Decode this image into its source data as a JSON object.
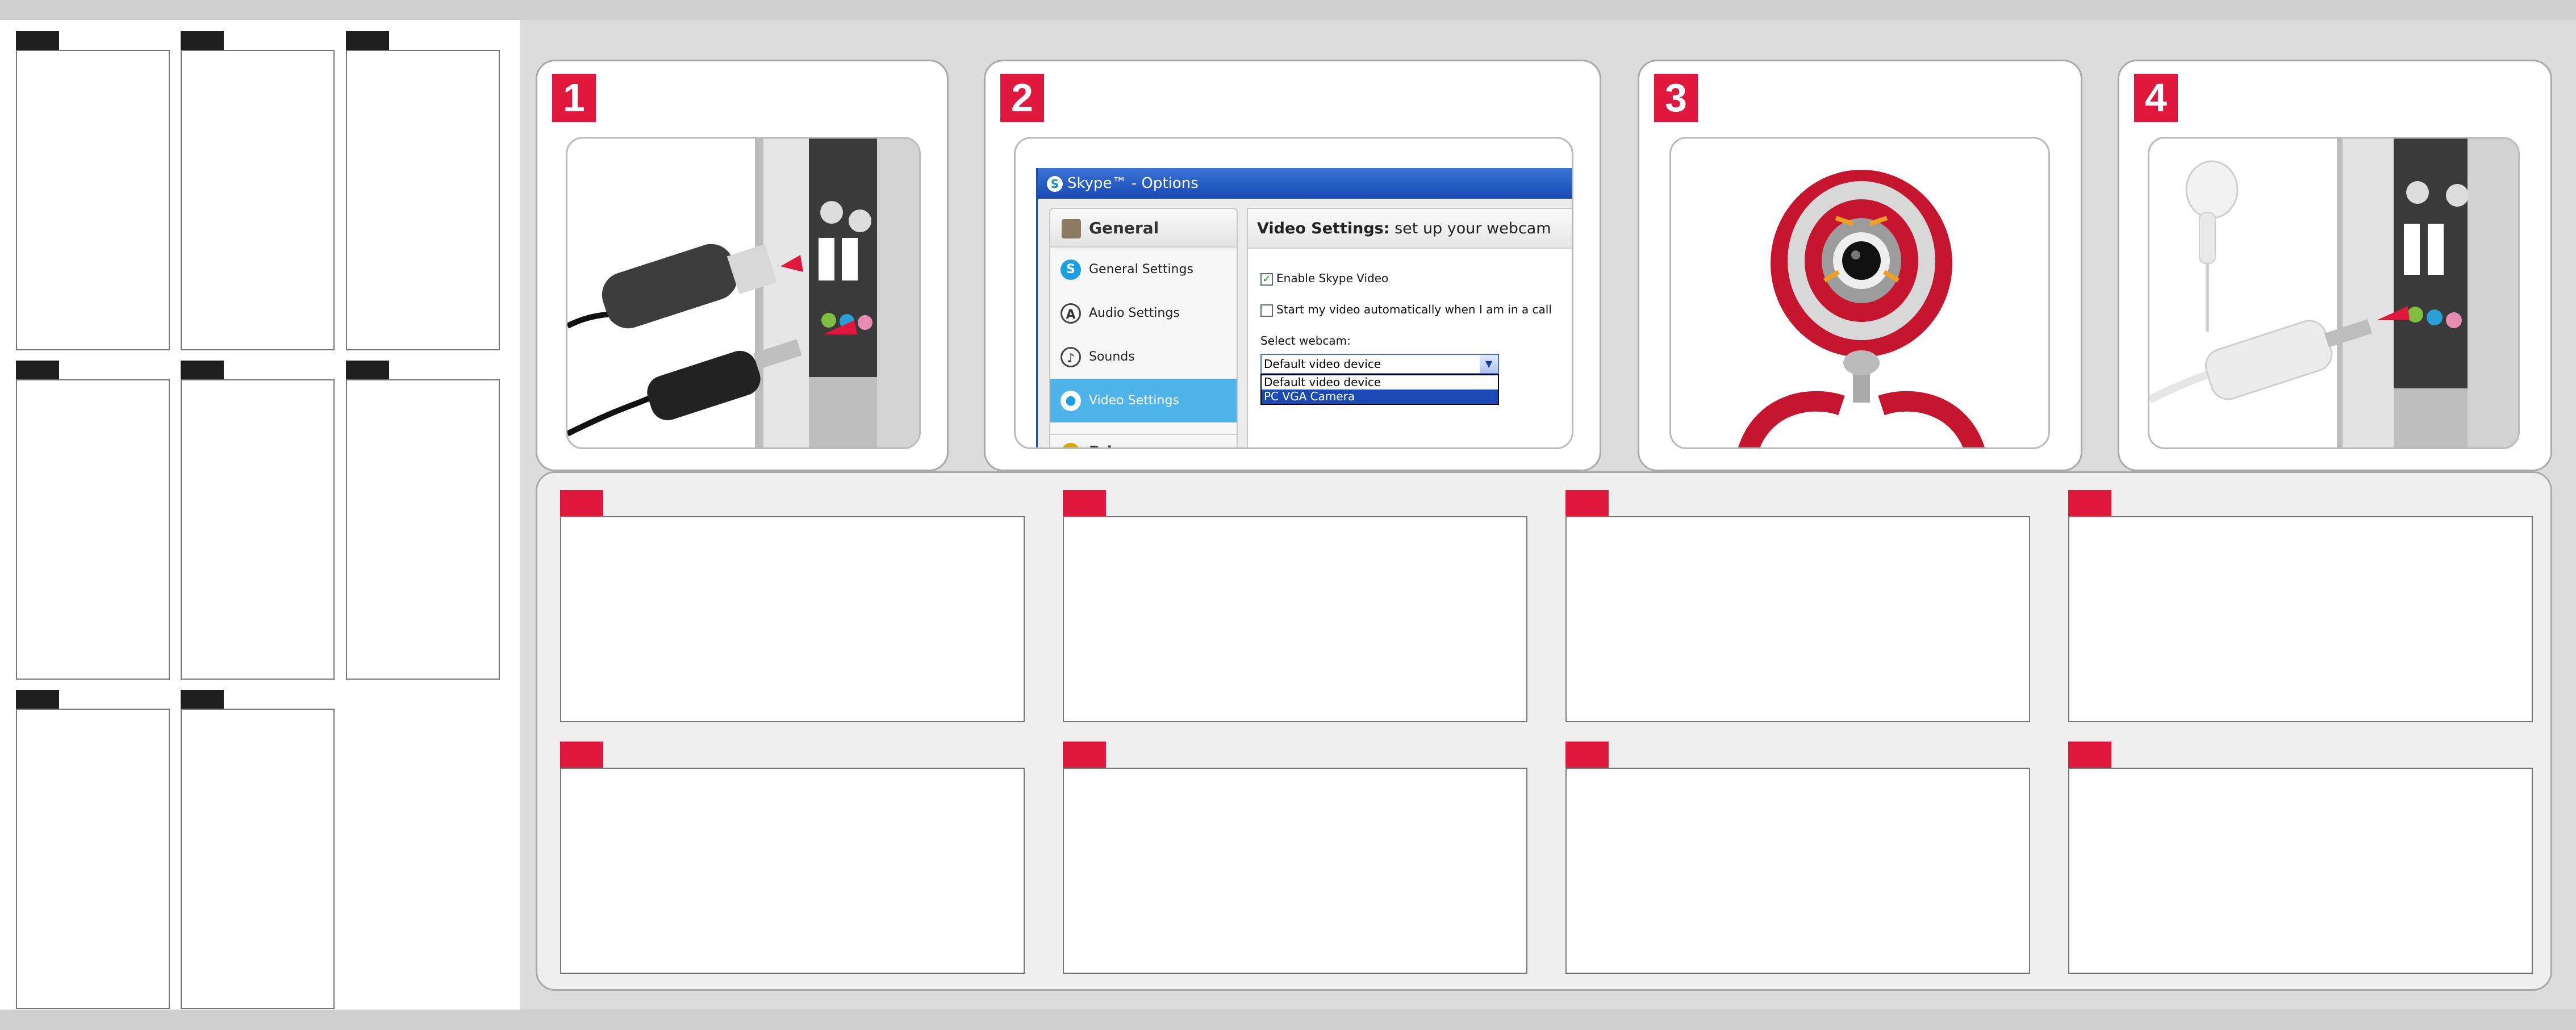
{
  "steps": [
    {
      "number": "1"
    },
    {
      "number": "2"
    },
    {
      "number": "3"
    },
    {
      "number": "4"
    }
  ],
  "skype_dialog": {
    "title": "Skype™ - Options",
    "logo_glyph": "S",
    "sidebar_header": "General",
    "sidebar_items": [
      "General Settings",
      "Audio Settings",
      "Sounds",
      "Video Settings"
    ],
    "selected_item": "Video Settings",
    "sidebar_footer": "Privacy",
    "main_heading_bold": "Video Settings:",
    "main_heading_rest": " set up your webcam",
    "enable_video_label": "Enable Skype Video",
    "enable_video_checked": true,
    "auto_start_label": "Start my video automatically when I am in a call",
    "auto_start_checked": false,
    "select_label": "Select webcam:",
    "select_value": "Default video device",
    "options": [
      "Default video device",
      "PC VGA Camera"
    ],
    "highlighted_option": "PC VGA Camera"
  },
  "colors": {
    "accent_red": "#e0183d",
    "tab_dark": "#1e1e1e",
    "skype_blue": "#1849b3",
    "selection_blue": "#4db3e8"
  }
}
